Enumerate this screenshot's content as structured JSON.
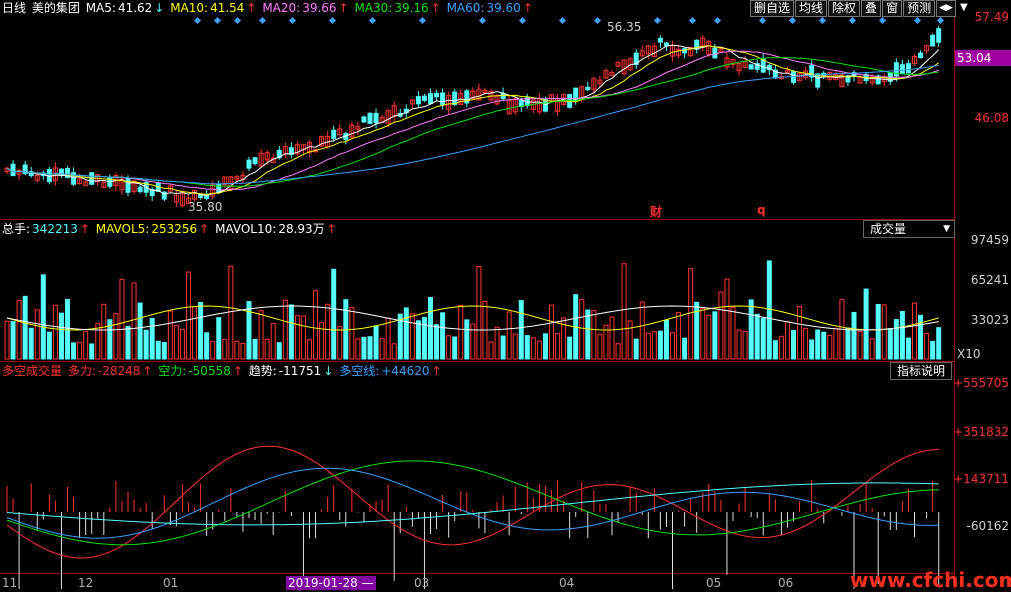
{
  "header": {
    "period": "日线",
    "stock_name": "美的集团",
    "ma5_label": "MA5:",
    "ma5_value": "41.62",
    "ma5_arrow": "↓",
    "ma10_label": "MA10:",
    "ma10_value": "41.54",
    "ma10_arrow": "↑",
    "ma20_label": "MA20:",
    "ma20_value": "39.66",
    "ma20_arrow": "↑",
    "ma30_label": "MA30:",
    "ma30_value": "39.16",
    "ma30_arrow": "↑",
    "ma60_label": "MA60:",
    "ma60_value": "39.60",
    "ma60_arrow": "↑"
  },
  "toolbar": {
    "buttons": [
      "删自选",
      "均线",
      "除权",
      "叠",
      "窗",
      "预测"
    ],
    "nav_glyph": "◀▶",
    "dropdown_glyph": "▼"
  },
  "price_axis": {
    "top": "57.49",
    "mid": "46.08",
    "current": "53.04"
  },
  "price_annotations": {
    "high": "56.35",
    "low": "35.80",
    "cai_marker": "财",
    "q_marker": "q"
  },
  "volume_header": {
    "total_label": "总手:",
    "total_value": "342213",
    "total_arrow": "↑",
    "mavol5_label": "MAVOL5:",
    "mavol5_value": "253256",
    "mavol5_arrow": "↑",
    "mavol10_label": "MAVOL10:",
    "mavol10_value": "28.93万",
    "mavol10_arrow": "↑",
    "selector": "成交量"
  },
  "volume_axis": {
    "a": "97459",
    "b": "65241",
    "c": "33023",
    "unit": "X10"
  },
  "indicator_header": {
    "name": "多空成交量",
    "duo_label": "多力:",
    "duo_value": "-28248",
    "duo_arrow": "↑",
    "kong_label": "空力:",
    "kong_value": "-50558",
    "kong_arrow": "↑",
    "trend_label": "趋势:",
    "trend_value": "-11751",
    "trend_arrow": "↓",
    "line_label": "多空线:",
    "line_value": "+44620",
    "line_arrow": "↑",
    "help": "指标说明"
  },
  "indicator_axis": {
    "a": "+555705",
    "b": "+351832",
    "c": "+143711",
    "d": "-60162"
  },
  "dates": {
    "d11": "11",
    "d12": "12",
    "d01": "01",
    "cursor": "2019-01-28 —",
    "d03": "03",
    "d04": "04",
    "d05": "05",
    "d06": "06"
  },
  "watermark": "www.cfchi.com",
  "colors": {
    "up": "#ff3232",
    "down": "#54fcfc",
    "ma5": "#ffffff",
    "ma10": "#ffff00",
    "ma20": "#ff80ff",
    "ma30": "#00e000",
    "ma60": "#3da0ff",
    "grid": "#a00000"
  }
}
